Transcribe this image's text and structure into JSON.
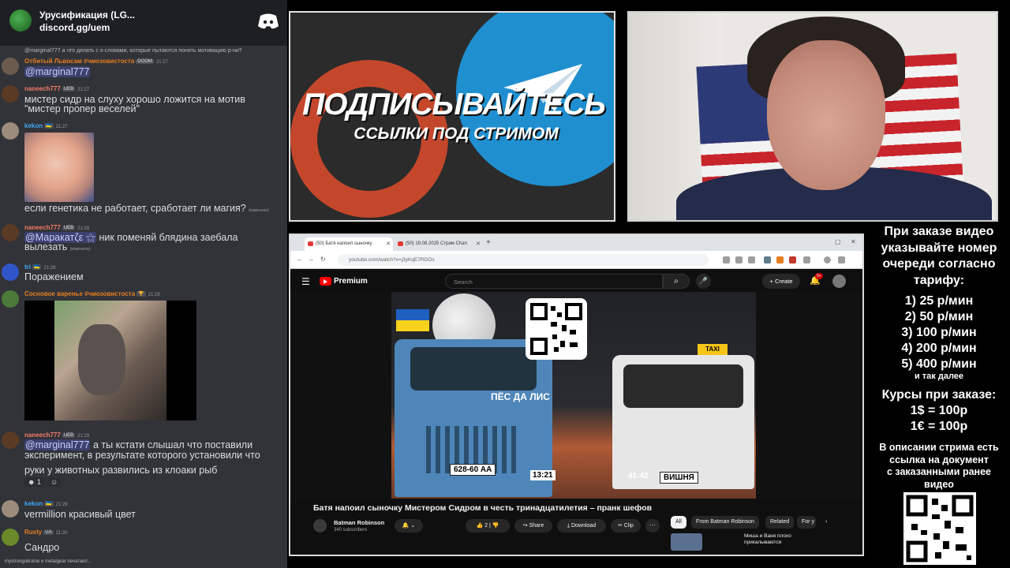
{
  "discord": {
    "server_name": "Урусификация (LG...",
    "invite": "discord.gg/uem",
    "messages": [
      {
        "reply": "@marginal777 а что делать с х-словами, которые пытаются понять мотивацию р-ни?",
        "user": "Отбитый Львосам #чмозовистоста",
        "badge": "DOOM",
        "time": "21:27",
        "text": "@marginal777"
      },
      {
        "user": "naneech777",
        "badge": "UEB",
        "time": "21:27",
        "text_lines": [
          "мистер сидр на слуху хорошо ложится на мотив",
          "\"мистер пропер веселей\""
        ]
      },
      {
        "user": "kekon",
        "badge": "🇺🇦",
        "time": "21:27",
        "text": "если генетика не работает, сработает ли магия?",
        "edited": "(изменено)"
      },
      {
        "user": "naneech777",
        "badge": "UEB",
        "time": "21:28",
        "mention": "@Маракатζε ⚝",
        "text": "ник поменяй блядина заебала",
        "text2": "вылезать",
        "edited": "(изменено)"
      },
      {
        "user": "tri",
        "badge": "🇺🇦",
        "time": "21:29",
        "text": "Поражением"
      },
      {
        "user": "Сосновое варенье #чмозовистоста",
        "badge": "🏆",
        "time": "21:29"
      },
      {
        "user": "naneech777",
        "badge": "UEB",
        "time": "21:29",
        "mention": "@marginal777",
        "text": "а ты кстати слышал что поставили",
        "text2": "эксперимент, в результате которого установили что",
        "text3": "руки у животных развились из клоаки рыб",
        "reactions": [
          "1",
          ""
        ]
      },
      {
        "user": "kekon",
        "badge": "🇺🇦",
        "time": "21:29",
        "text": "vermillion красивый цвет"
      },
      {
        "user": "Rusty",
        "badge": "UA",
        "time": "21:30",
        "text": "Сандро"
      }
    ],
    "typing": "mystrongukraine и metalgear печатают..."
  },
  "promo": {
    "title": "ПОДПИСЫВАЙТЕСЬ",
    "subtitle": "ССЫЛКИ ПОД СТРИМОМ"
  },
  "prices": {
    "header": [
      "При заказе видео",
      "указывайте номер",
      "очереди согласно",
      "тарифу:"
    ],
    "items": [
      "1) 25 р/мин",
      "2) 50 р/мин",
      "3) 100 р/мин",
      "4) 200 р/мин",
      "5) 400 р/мин"
    ],
    "more": "и так далее",
    "courses_title": "Курсы при заказе:",
    "courses": [
      "1$ = 100р",
      "1€ = 100р"
    ],
    "desc": [
      "В описании стрима есть",
      "ссылка на документ",
      "с заказанными ранее",
      "видео"
    ]
  },
  "browser": {
    "tabs": [
      "(50) Батя напоил сыночку",
      "(50) 19.08.2025 Стрим Chan"
    ],
    "url": "youtube.com/watch?v=j3yKqE7RDOs",
    "yt_brand": "Premium",
    "search_placeholder": "Search",
    "create": "Create",
    "notif_badge": "9+",
    "video": {
      "title": "Батя напоил сыночку Мистером Сидром в честь тринадцатилетия – пранк шефов",
      "channel": "Batman Robinson",
      "subs": "340 subscribers",
      "likes": "2",
      "share": "Share",
      "download": "Download",
      "clip": "Clip",
      "chips": [
        "All",
        "From Batman Robinson",
        "Related",
        "For y"
      ],
      "rec_title_1": "Миша и Ваня плохо",
      "rec_title_2": "прикалываются"
    },
    "thumb": {
      "sign": "ПЁС ДА ЛИС",
      "plate_left": "628-60 АА",
      "clock_left": "13:21",
      "clock_right": "41:42",
      "plate_right": "ВИШНЯ",
      "taxi": "TAXI"
    }
  }
}
